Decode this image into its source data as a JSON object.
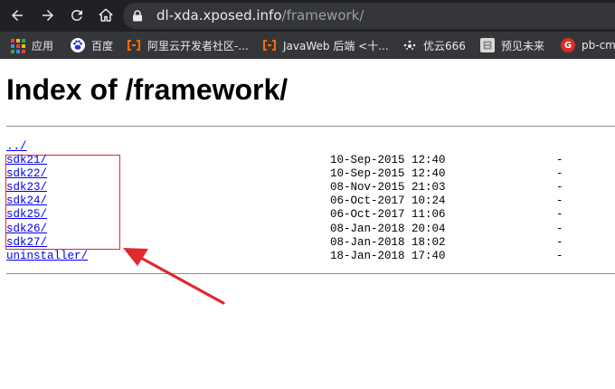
{
  "browser": {
    "url_host": "dl-xda.xposed.info",
    "url_path": "/framework/",
    "bookmarks": [
      {
        "label": "应用",
        "icon": "apps-grid-icon"
      },
      {
        "label": "百度",
        "icon": "baidu-paw-icon"
      },
      {
        "label": "阿里云开发者社区-...",
        "icon": "aliyun-icon"
      },
      {
        "label": "JavaWeb 后端 <十...",
        "icon": "aliyun-icon"
      },
      {
        "label": "优云666",
        "icon": "cloud-dots-icon"
      },
      {
        "label": "预见未来",
        "icon": "page-icon"
      },
      {
        "label": "pb-cm",
        "icon": "g-logo-icon"
      }
    ]
  },
  "page": {
    "title": "Index of /framework/",
    "parent_link": "../",
    "entries": [
      {
        "name": "sdk21/",
        "date": "10-Sep-2015 12:40",
        "size": "-"
      },
      {
        "name": "sdk22/",
        "date": "10-Sep-2015 12:40",
        "size": "-"
      },
      {
        "name": "sdk23/",
        "date": "08-Nov-2015 21:03",
        "size": "-"
      },
      {
        "name": "sdk24/",
        "date": "06-Oct-2017 10:24",
        "size": "-"
      },
      {
        "name": "sdk25/",
        "date": "06-Oct-2017 11:06",
        "size": "-"
      },
      {
        "name": "sdk26/",
        "date": "08-Jan-2018 20:04",
        "size": "-"
      },
      {
        "name": "sdk27/",
        "date": "08-Jan-2018 18:02",
        "size": "-"
      },
      {
        "name": "uninstaller/",
        "date": "18-Jan-2018 17:40",
        "size": "-"
      }
    ]
  },
  "colors": {
    "chrome_dark": "#202124",
    "omnibox": "#35363a",
    "link": "#0000ee",
    "annotation_red": "#e0282f"
  }
}
